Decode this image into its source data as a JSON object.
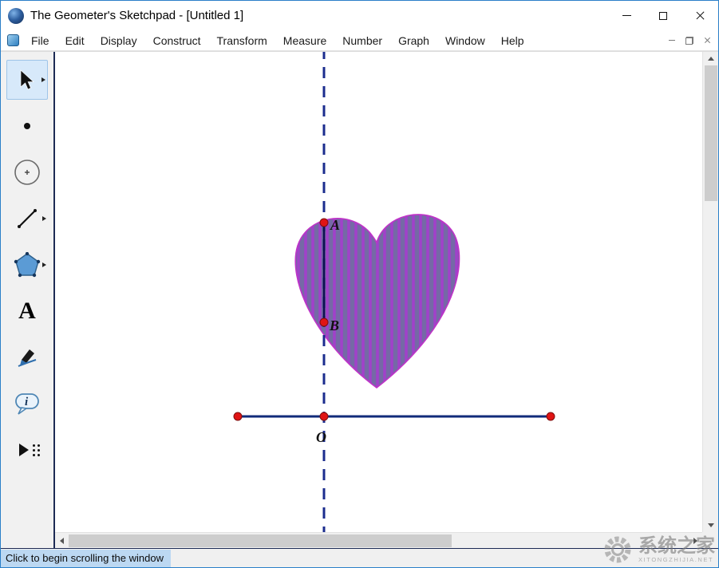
{
  "window": {
    "title": "The Geometer's Sketchpad - [Untitled 1]"
  },
  "menu": {
    "items": [
      "File",
      "Edit",
      "Display",
      "Construct",
      "Transform",
      "Measure",
      "Number",
      "Graph",
      "Window",
      "Help"
    ]
  },
  "toolbar": {
    "selected_tool": "selection-arrow",
    "text_tool_glyph": "A",
    "info_tool_glyph": "i"
  },
  "canvas": {
    "labels": {
      "a": "A",
      "b": "B",
      "o": "O"
    },
    "colors": {
      "dashed_line": "#1b2c8e",
      "segment": "#0d1050",
      "axis_segment": "#102a7a",
      "point": "#e01414",
      "heart_fill": "#7569a6",
      "heart_stripe": "#aa3bd1",
      "heart_outline": "#c033c8"
    }
  },
  "status": {
    "message": "Click to begin scrolling the window"
  },
  "watermark": {
    "title": "系统之家",
    "subtitle": "XITONGZHIJIA.NET"
  }
}
